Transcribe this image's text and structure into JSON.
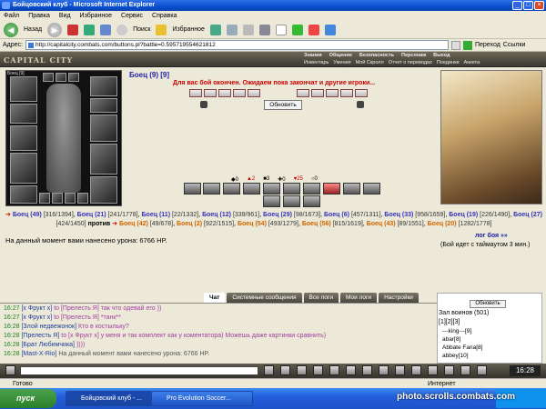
{
  "window": {
    "title": "Бойцовский клуб - Microsoft Internet Explorer"
  },
  "menu": [
    "Файл",
    "Правка",
    "Вид",
    "Избранное",
    "Сервис",
    "Справка"
  ],
  "toolbar": {
    "back": "Назад",
    "search": "Поиск",
    "favorites": "Избранное"
  },
  "address": {
    "label": "Адрес:",
    "url": "http://capitalcity.combats.com/buttons.pl?battle=0.595719554621812",
    "go": "Переход",
    "links": "Ссылки"
  },
  "game": {
    "logo": "CAPITAL CITY",
    "nav_top": [
      "Знания",
      "Общение",
      "Безопасность",
      "Персонаж",
      "Выход"
    ],
    "nav_bottom": [
      "Инвентарь",
      "Умения",
      "Мой Скролл",
      "Отчет о переводах",
      "Поединки",
      "Анкета"
    ],
    "char_label": "Боец [9]",
    "fighter_title": "Боец (9) [9]",
    "status": "Для вас бой окончен. Ожидаем пока закончат и другие игроки...",
    "refresh": "Обновить",
    "stats": [
      "0",
      "2",
      "3",
      "0",
      "25",
      "0"
    ],
    "team1": [
      {
        "name": "Боец (49)",
        "hp": "[316/1394]"
      },
      {
        "name": "Боец (21)",
        "hp": "[241/1778]"
      },
      {
        "name": "Боец (11)",
        "hp": "[22/1332]"
      },
      {
        "name": "Боец (12)",
        "hp": "[339/961]"
      },
      {
        "name": "Боец (29)",
        "hp": "[98/1673]"
      },
      {
        "name": "Боец (6)",
        "hp": "[457/1311]"
      },
      {
        "name": "Боец (33)",
        "hp": "[958/1659]"
      },
      {
        "name": "Боец (19)",
        "hp": "[226/1490]"
      },
      {
        "name": "Боец (27)",
        "hp": "[424/1450]"
      }
    ],
    "vs": "против",
    "team2": [
      {
        "name": "Боец (42)",
        "hp": "[49/678]"
      },
      {
        "name": "Боец (2)",
        "hp": "[922/1515]"
      },
      {
        "name": "Боец (54)",
        "hp": "[493/1279]"
      },
      {
        "name": "Боец (56)",
        "hp": "[815/1619]"
      },
      {
        "name": "Боец (43)",
        "hp": "[89/1551]"
      },
      {
        "name": "Боец (20)",
        "hp": "[1282/1778]"
      }
    ],
    "damage": "На данный момент вами нанесено урона: 6766 HP.",
    "battle_log": "лог боя »»",
    "timeout": "(Бой идет с таймаутом 3 мин.)"
  },
  "chat": {
    "tabs": [
      "Чат",
      "Системные сообщения",
      "Все логи",
      "Мои логи",
      "Настройки"
    ],
    "messages": [
      {
        "time": "16:27",
        "nick": "[x Фрукт x]",
        "text": "to [Прелесть Я] так что одевай его ))"
      },
      {
        "time": "16:27",
        "nick": "[x Фрукт x]",
        "text": "to [Прелесть Я] *танк**"
      },
      {
        "time": "16:28",
        "nick": "[Злой недвежонок]",
        "text": "Кто в костыльку?"
      },
      {
        "time": "16:28",
        "nick": "[Прелесть Я]",
        "text": "to [x Фрукт x] у меня и так комплект как у коментатора) Можешь даже картинки сравнить)"
      },
      {
        "time": "16:28",
        "nick": "[Брат Любимчика]",
        "text": "))))"
      },
      {
        "time": "16:28",
        "nick": "[Mast-X-Rio]",
        "text": "На данный момент вами нанесено урона: 6766 HP."
      }
    ],
    "right": {
      "refresh": "Обновить",
      "title": "Зал воинов (501)",
      "pages": "[1][2][3]",
      "users": [
        "---king---[9]",
        "abar[8]",
        "Abbate Faria[8]",
        "abbey[10]"
      ]
    }
  },
  "statusbar": {
    "left": "Готово",
    "right": "Интернет"
  },
  "taskbar": {
    "start": "пуск",
    "tasks": [
      "Бойцовский клуб - ...",
      "Pro Evolution Soccer..."
    ],
    "watermark": "photo.scrolls.combats.com",
    "clock": "16:28"
  }
}
